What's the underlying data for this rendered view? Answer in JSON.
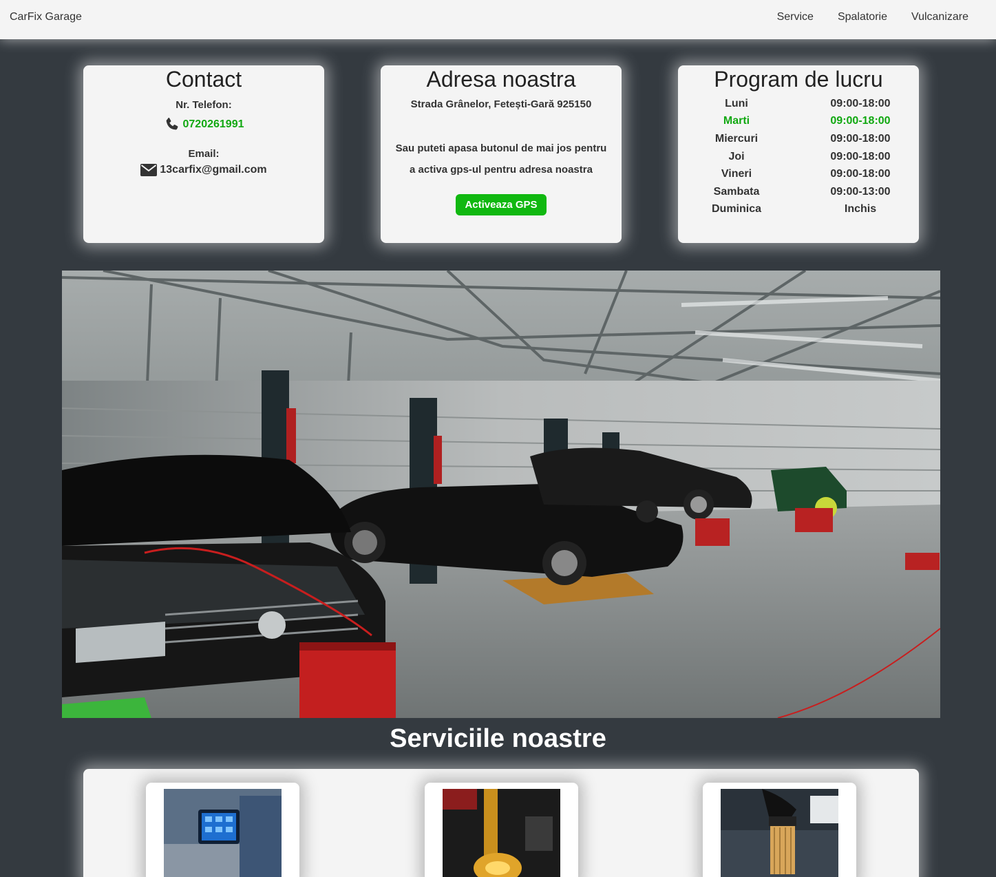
{
  "navbar": {
    "brand": "CarFix Garage",
    "links": [
      "Service",
      "Spalatorie",
      "Vulcanizare"
    ]
  },
  "contact": {
    "title": "Contact",
    "phone_label": "Nr. Telefon:",
    "phone": "0720261991",
    "email_label": "Email:",
    "email": "13carfix@gmail.com"
  },
  "address": {
    "title": "Adresa noastra",
    "street": "Strada Grânelor, Fetești-Gară 925150",
    "note": "Sau puteti apasa butonul de mai jos pentru a activa gps-ul pentru adresa noastra",
    "button": "Activeaza GPS"
  },
  "hours": {
    "title": "Program de lucru",
    "rows": [
      {
        "day": "Luni",
        "time": "09:00-18:00"
      },
      {
        "day": "Marti",
        "time": "09:00-18:00"
      },
      {
        "day": "Miercuri",
        "time": "09:00-18:00"
      },
      {
        "day": "Joi",
        "time": "09:00-18:00"
      },
      {
        "day": "Vineri",
        "time": "09:00-18:00"
      },
      {
        "day": "Sambata",
        "time": "09:00-13:00"
      },
      {
        "day": "Duminica",
        "time": "Inchis"
      }
    ],
    "highlight_color": "#11a811"
  },
  "services": {
    "title": "Serviciile noastre"
  },
  "colors": {
    "background": "#343a40",
    "card": "#f4f4f4",
    "accent": "#10b810"
  }
}
